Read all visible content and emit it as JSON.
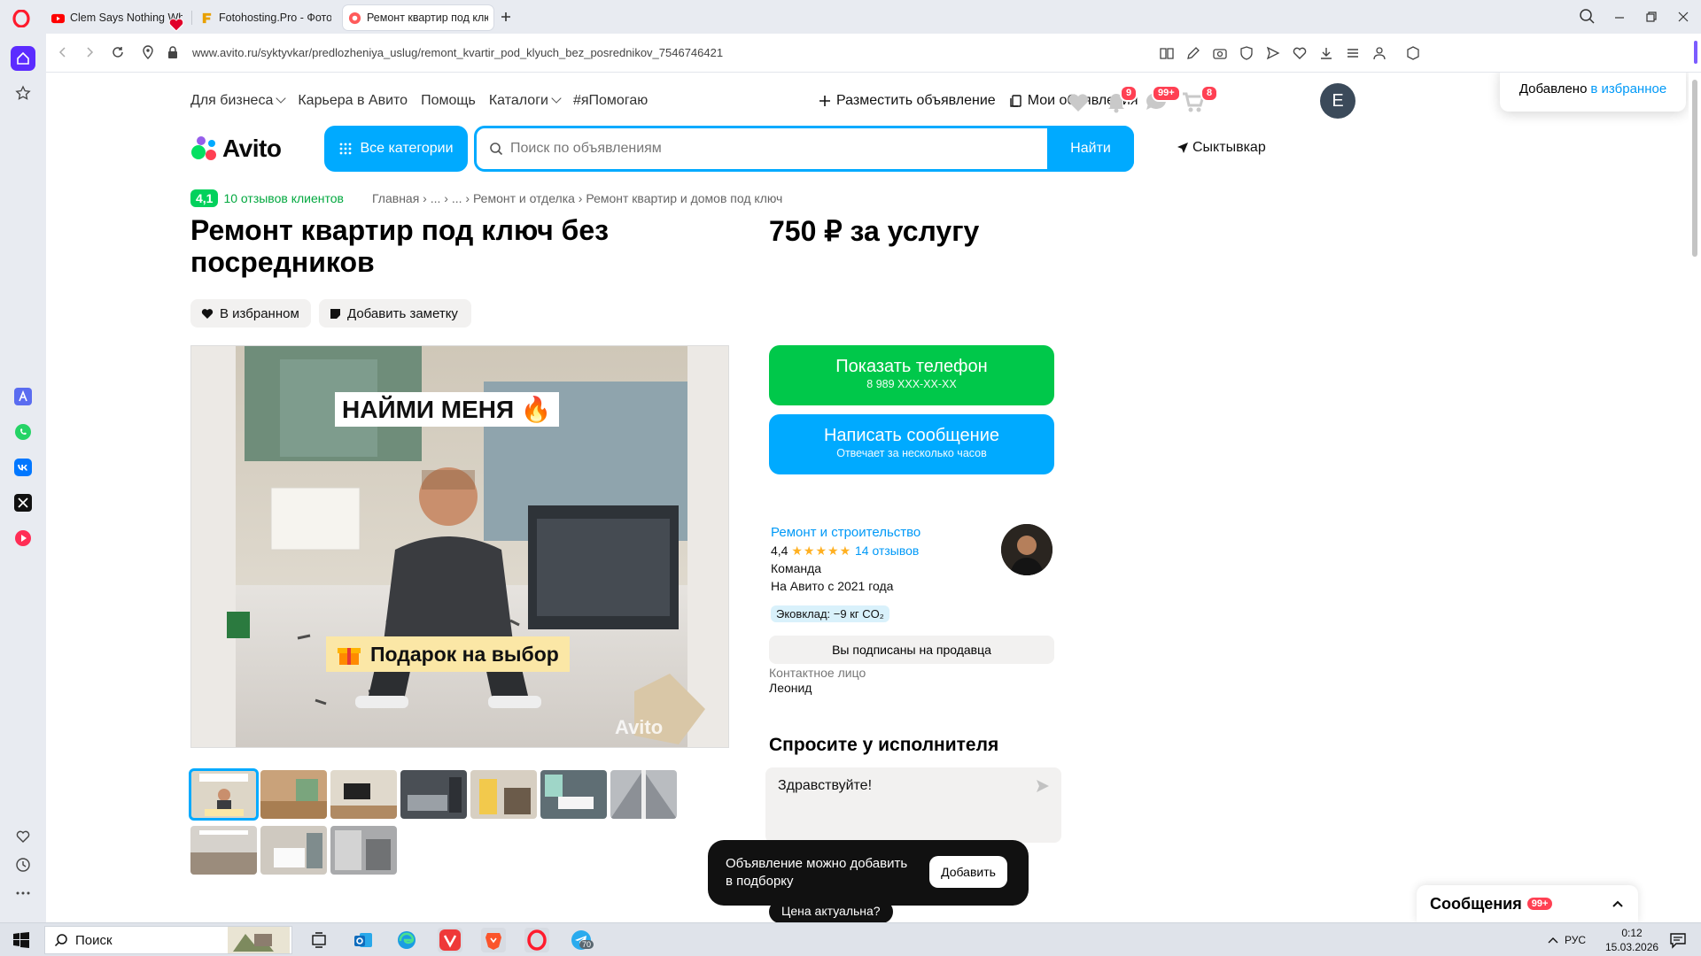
{
  "browser": {
    "tabs": [
      {
        "title": "Clem Says Nothing While",
        "favicon": "youtube-icon",
        "active": false
      },
      {
        "title": "Fotohosting.Pro - Фотохо",
        "favicon": "fotohosting-icon",
        "active": false
      },
      {
        "title": "Ремонт квартир под клю",
        "favicon": "avito-icon",
        "active": true
      }
    ],
    "url": "www.avito.ru/syktyvkar/predlozheniya_uslug/remont_kvartir_pod_klyuch_bez_posrednikov_7546746421"
  },
  "header": {
    "links": [
      "Для бизнеса",
      "Карьера в Авито",
      "Помощь",
      "Каталоги",
      "#яПомогаю"
    ],
    "post_ad": "Разместить объявление",
    "my_ads": "Мои объявления",
    "badges": {
      "notifications": "9",
      "messages": "99+",
      "cart": "8"
    },
    "avatar_letter": "E",
    "logo": "Avito",
    "categories_button": "Все категории",
    "search_placeholder": "Поиск по объявлениям",
    "search_button": "Найти",
    "city": "Сыктывкар"
  },
  "favorites_popup": {
    "prefix": "Добавлено",
    "link": "в избранное"
  },
  "listing": {
    "rating_score": "4,1",
    "reviews_link": "10 отзывов клиентов",
    "breadcrumbs": "Главная › ... › ... › Ремонт и отделка › Ремонт квартир и домов под ключ",
    "title": "Ремонт квартир под ключ без посредников",
    "price": "750 ₽ за услугу",
    "favorite_button": "В избранном",
    "note_button": "Добавить заметку",
    "photo_banner_top": "НАЙМИ МЕНЯ",
    "photo_banner_bottom": "Подарок на выбор",
    "photo_watermark": "Avito"
  },
  "contact": {
    "show_phone": "Показать телефон",
    "phone_masked": "8 989 XXX-XX-XX",
    "write_message": "Написать сообщение",
    "reply_time": "Отвечает за несколько часов"
  },
  "seller": {
    "name": "Ремонт и строительство",
    "rating": "4,4",
    "stars": "★★★★★",
    "reviews": "14 отзывов",
    "type": "Команда",
    "since": "На Авито с 2021 года",
    "eco": "Эковклад: −9 кг CO₂",
    "subscribed": "Вы подписаны на продавца",
    "contact_label": "Контактное лицо",
    "contact_name": "Леонид"
  },
  "ask": {
    "title": "Спросите у исполнителя",
    "message": "Здравствуйте!",
    "quick_chip": "Цена актуальна?"
  },
  "toast": {
    "message": "Объявление можно добавить в подборку",
    "button": "Добавить"
  },
  "messages_widget": {
    "label": "Сообщения",
    "badge": "99+"
  },
  "taskbar": {
    "search": "Поиск",
    "lang": "РУС",
    "time": "0:12",
    "date": "15.03.2026",
    "telegram_badge": "70"
  }
}
